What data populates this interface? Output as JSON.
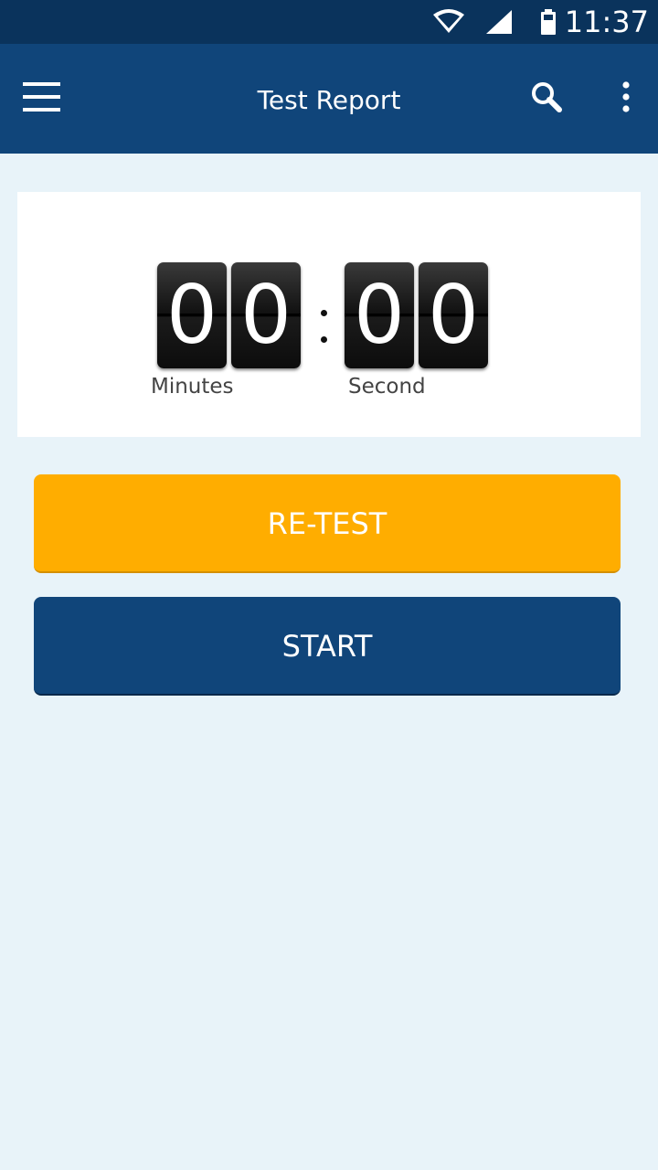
{
  "status_bar": {
    "time": "11:37",
    "icons": [
      "wifi-icon",
      "signal-icon",
      "battery-icon"
    ]
  },
  "app_bar": {
    "title": "Test Report",
    "menu_icon": "hamburger-menu-icon",
    "search_icon": "search-icon",
    "overflow_icon": "more-vertical-icon"
  },
  "timer": {
    "minutes_digits": [
      "0",
      "0"
    ],
    "seconds_digits": [
      "0",
      "0"
    ],
    "separator": ":",
    "minutes_label": "Minutes",
    "seconds_label": "Second"
  },
  "actions": {
    "retest_label": "RE-TEST",
    "start_label": "START"
  },
  "colors": {
    "status_bar": "#0a335c",
    "app_bar": "#10457a",
    "background": "#e8f3f9",
    "retest": "#ffad00",
    "start": "#10457a"
  }
}
